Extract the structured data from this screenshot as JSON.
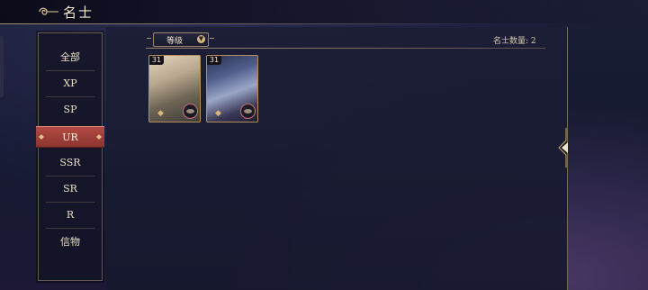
{
  "header": {
    "title": "名士",
    "ornament_icon": "swirl-ornament-icon"
  },
  "sidebar": {
    "items": [
      {
        "label": "全部",
        "active": false
      },
      {
        "label": "XP",
        "active": false
      },
      {
        "label": "SP",
        "active": false
      },
      {
        "label": "UR",
        "active": true
      },
      {
        "label": "SSR",
        "active": false
      },
      {
        "label": "SR",
        "active": false
      },
      {
        "label": "R",
        "active": false
      },
      {
        "label": "信物",
        "active": false
      }
    ]
  },
  "filter": {
    "sort_label": "等级",
    "count_text": "名士数量: 2"
  },
  "cards": [
    {
      "level": "31",
      "portrait": "blonde-character-portrait"
    },
    {
      "level": "31",
      "portrait": "blue-haired-character-portrait"
    }
  ],
  "colors": {
    "accent_gold": "#c9a66b",
    "active_tab": "#a8433c",
    "background": "#161a32"
  }
}
